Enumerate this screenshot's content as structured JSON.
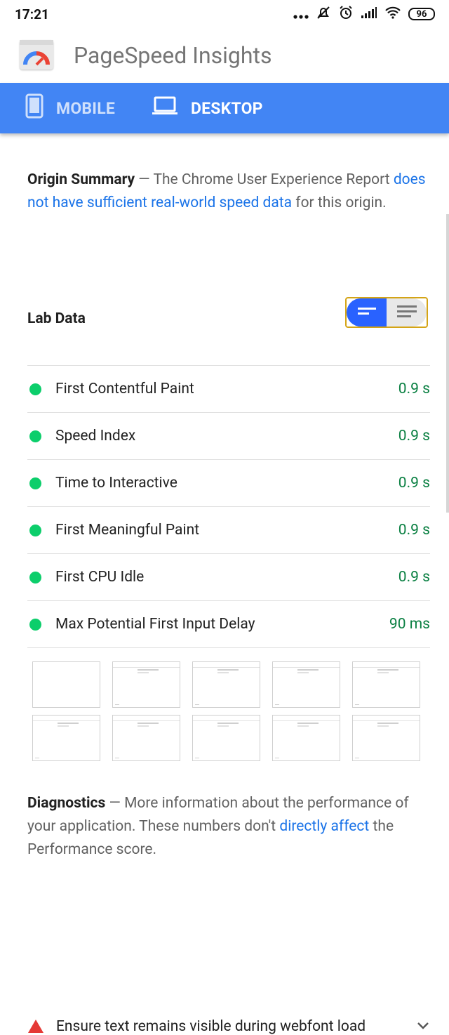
{
  "status_bar": {
    "time": "17:21",
    "battery": "96",
    "icons": [
      "more-icon",
      "mute-icon",
      "alarm-icon",
      "signal-icon",
      "wifi-icon",
      "battery-icon"
    ]
  },
  "app": {
    "title": "PageSpeed Insights",
    "logo": "pagespeed-logo-icon"
  },
  "tabs": [
    {
      "label": "MOBILE",
      "icon": "phone-icon",
      "selected": false
    },
    {
      "label": "DESKTOP",
      "icon": "laptop-icon",
      "selected": true
    }
  ],
  "origin_summary": {
    "title": "Origin Summary",
    "text_before": "— The Chrome User Experience Report ",
    "link": "does not have sufficient real-world speed data",
    "text_after": " for this origin."
  },
  "lab_data": {
    "title": "Lab Data",
    "toggle": {
      "active": "summary-view",
      "inactive": "detail-view"
    },
    "metrics": [
      {
        "name": "First Contentful Paint",
        "value": "0.9 s"
      },
      {
        "name": "Speed Index",
        "value": "0.9 s"
      },
      {
        "name": "Time to Interactive",
        "value": "0.9 s"
      },
      {
        "name": "First Meaningful Paint",
        "value": "0.9 s"
      },
      {
        "name": "First CPU Idle",
        "value": "0.9 s"
      },
      {
        "name": "Max Potential First Input Delay",
        "value": "90 ms"
      }
    ]
  },
  "diagnostics": {
    "title": "Diagnostics",
    "text_before": "— More information about the performance of your application. These numbers don't ",
    "link": "directly affect",
    "text_after": " the Performance score.",
    "first_audit": "Ensure text remains visible during webfont load"
  },
  "colors": {
    "accent": "#4285f4",
    "pass": "#0cce6b",
    "pass_text": "#0b8043",
    "link": "#1a73e8",
    "toggle_border": "#d4a416"
  }
}
